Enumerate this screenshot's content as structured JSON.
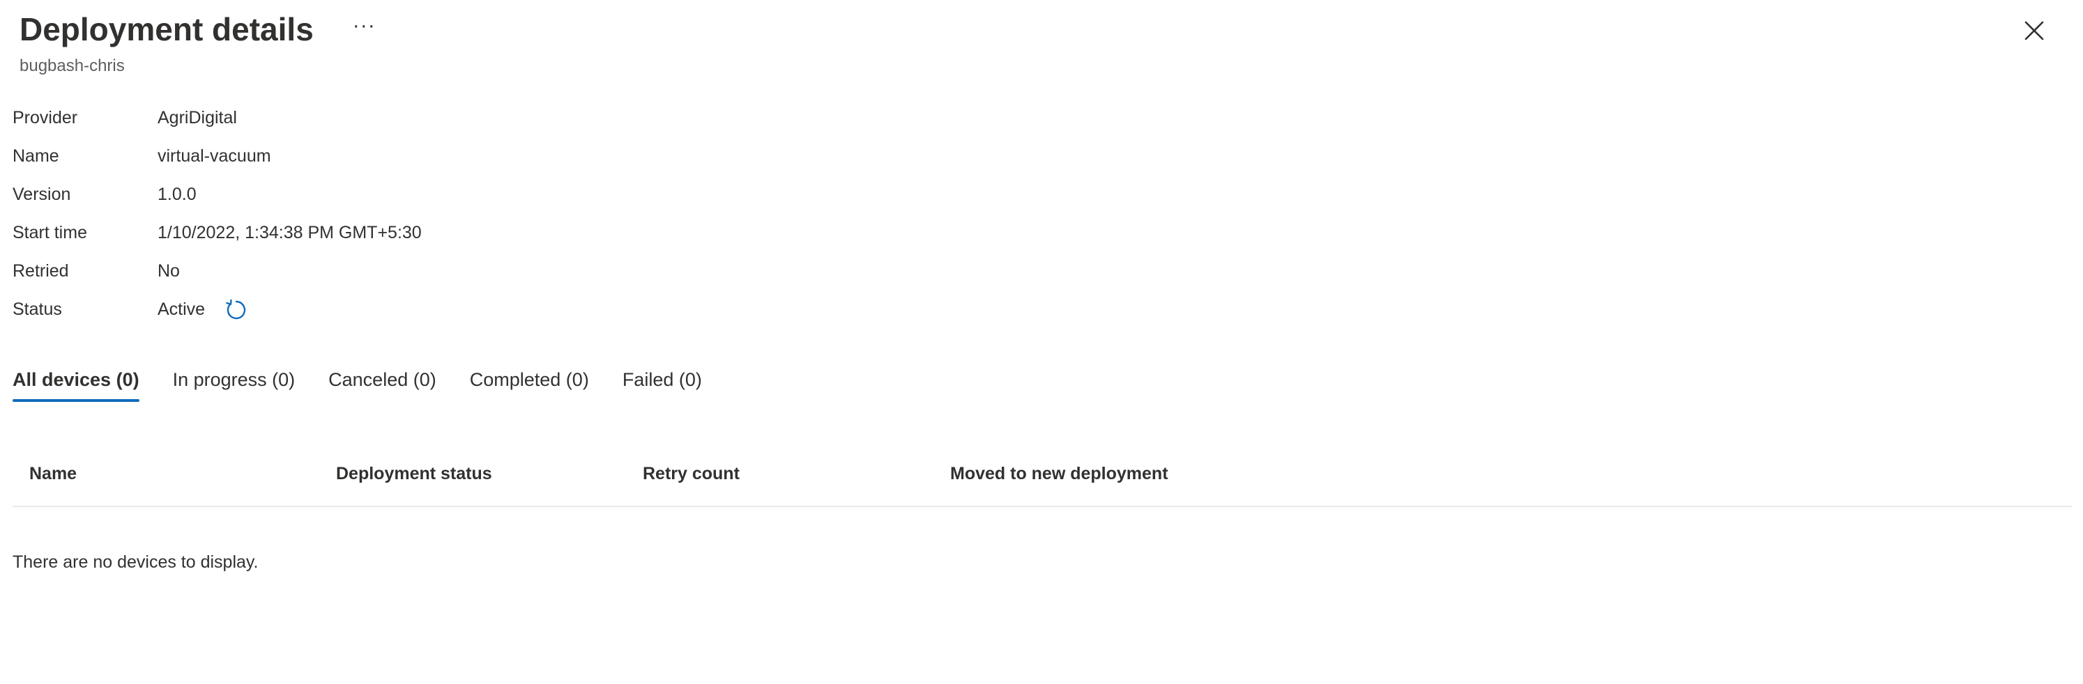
{
  "header": {
    "title": "Deployment details",
    "more_label": "···",
    "subtitle": "bugbash-chris",
    "close_icon": "close-icon"
  },
  "properties": [
    {
      "label": "Provider",
      "value": "AgriDigital"
    },
    {
      "label": "Name",
      "value": "virtual-vacuum"
    },
    {
      "label": "Version",
      "value": "1.0.0"
    },
    {
      "label": "Start time",
      "value": "1/10/2022, 1:34:38 PM GMT+5:30"
    },
    {
      "label": "Retried",
      "value": "No"
    },
    {
      "label": "Status",
      "value": "Active",
      "icon": "refresh-icon"
    }
  ],
  "tabs": [
    {
      "label": "All devices (0)",
      "active": true
    },
    {
      "label": "In progress (0)",
      "active": false
    },
    {
      "label": "Canceled (0)",
      "active": false
    },
    {
      "label": "Completed (0)",
      "active": false
    },
    {
      "label": "Failed (0)",
      "active": false
    }
  ],
  "table": {
    "columns": [
      "Name",
      "Deployment status",
      "Retry count",
      "Moved to new deployment"
    ],
    "empty_message": "There are no devices to display."
  },
  "colors": {
    "accent": "#0f6cbd",
    "text": "#323130",
    "subtext": "#605e5c",
    "divider": "#edebe9"
  }
}
